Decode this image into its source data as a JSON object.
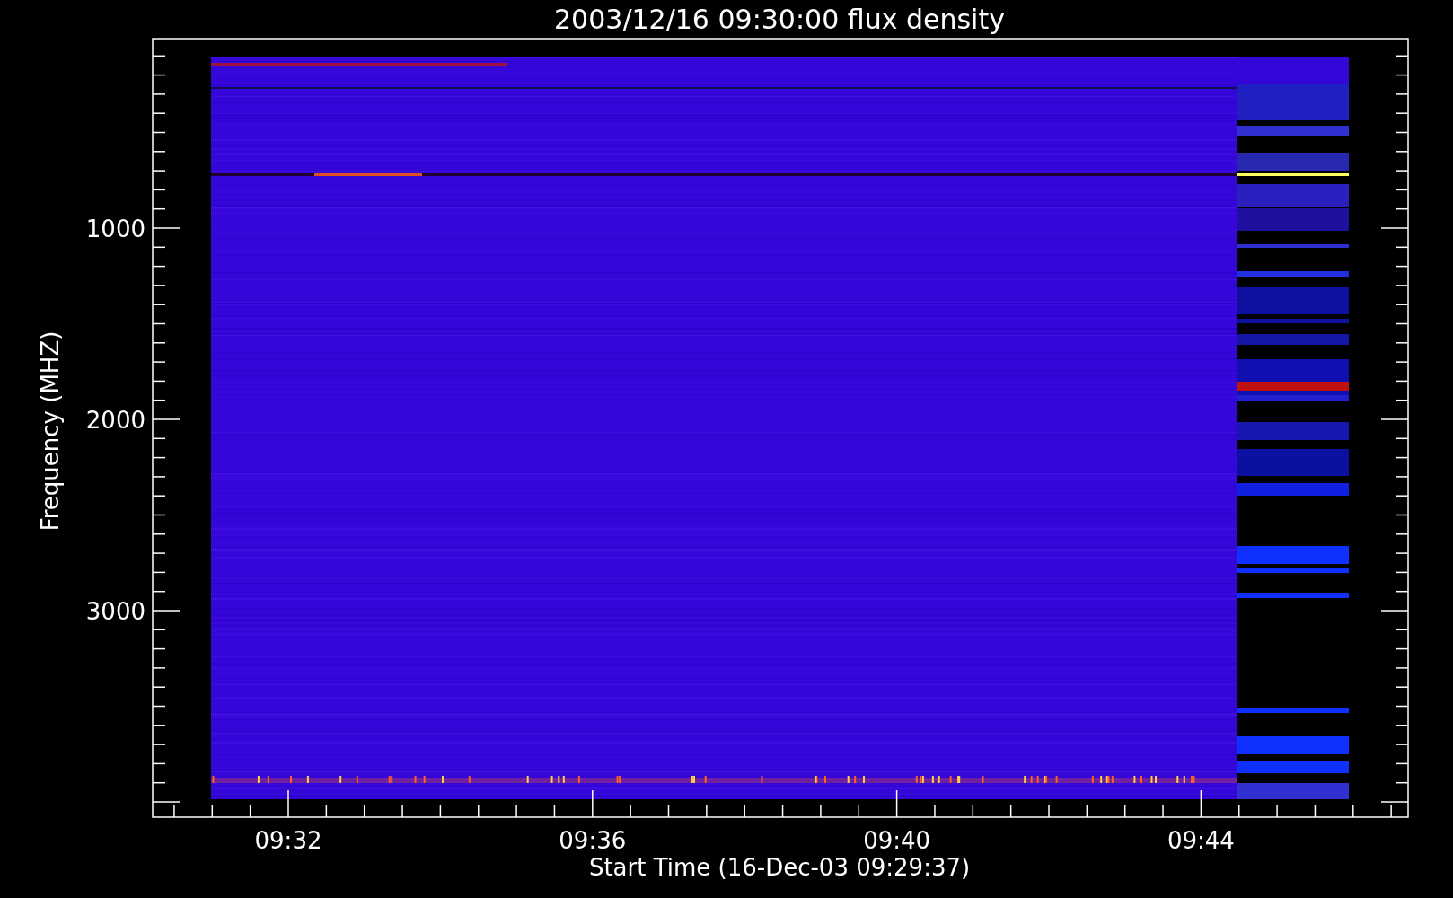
{
  "plot": {
    "title": "2003/12/16 09:30:00 flux density",
    "ylabel": "Frequency (MHZ)",
    "xlabel": "Start Time (16-Dec-03 09:29:37)",
    "yticks": [
      "1000",
      "2000",
      "3000"
    ],
    "xticks": [
      "09:32",
      "09:36",
      "09:40",
      "09:44"
    ]
  }
}
